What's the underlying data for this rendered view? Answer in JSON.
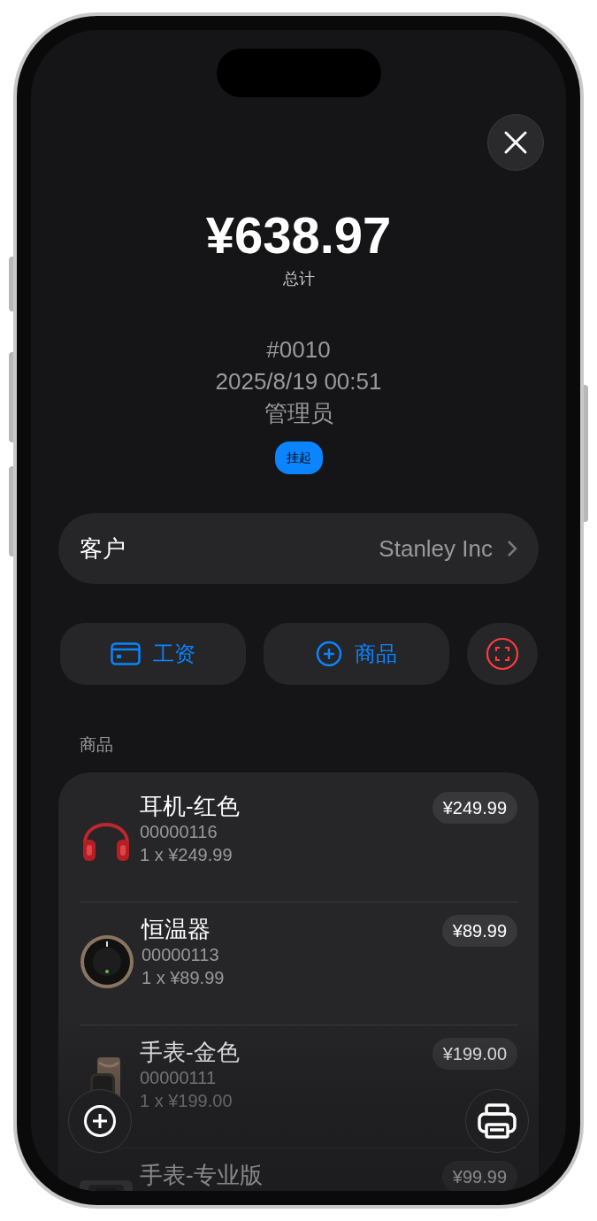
{
  "total": {
    "amount": "¥638.97",
    "label": "总计"
  },
  "order": {
    "number": "#0010",
    "datetime": "2025/8/19 00:51",
    "operator": "管理员",
    "status": "挂起"
  },
  "customer": {
    "label": "客户",
    "value": "Stanley Inc"
  },
  "actions": [
    {
      "kind": "card",
      "label": "工资"
    },
    {
      "kind": "add",
      "label": "商品"
    },
    {
      "kind": "scan"
    }
  ],
  "section_title": "商品",
  "items": [
    {
      "name": "耳机-红色",
      "code": "00000116",
      "quantity": "1 x ¥249.99",
      "price": "¥249.99"
    },
    {
      "name": "恒温器",
      "code": "00000113",
      "quantity": "1 x ¥89.99",
      "price": "¥89.99"
    },
    {
      "name": "手表-金色",
      "code": "00000111",
      "quantity": "1 x ¥199.00",
      "price": "¥199.00"
    },
    {
      "name": "手表-专业版",
      "price": "¥99.99"
    }
  ]
}
